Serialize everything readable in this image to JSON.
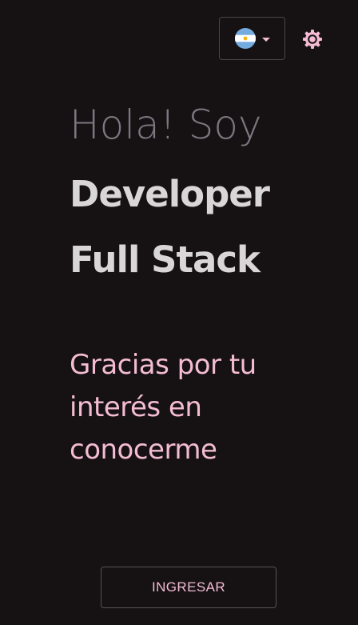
{
  "header": {
    "language_icon": "argentina-flag-icon",
    "dropdown_icon": "caret-down-icon",
    "theme_icon": "sun-gear-icon",
    "accent_color": "#f4bcd2"
  },
  "hero": {
    "greeting": "Hola! Soy",
    "role_line_1": "Developer",
    "role_line_2": "Full Stack",
    "thanks_line_1": "Gracias por tu",
    "thanks_line_2": "interés en",
    "thanks_line_3": "conocerme"
  },
  "cta": {
    "label": "INGRESAR"
  }
}
